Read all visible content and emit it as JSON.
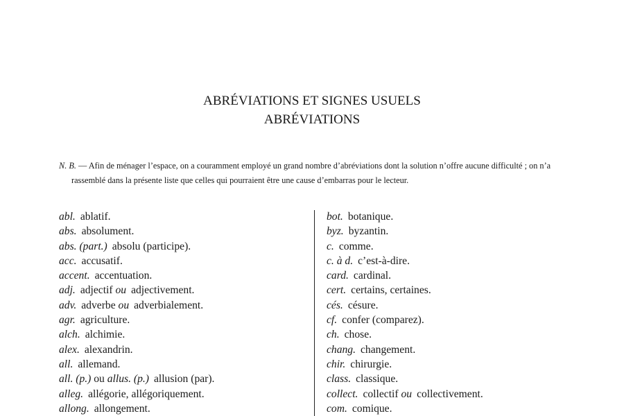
{
  "header": {
    "title": "ABRÉVIATIONS ET SIGNES USUELS",
    "subtitle": "ABRÉVIATIONS"
  },
  "note": {
    "label": "N. B.",
    "text": " — Afin de ménager l’espace, on a couramment employé un grand nombre d’abréviations dont la solution n’offre aucune difficulté ; on n’a rassemblé dans la présente liste que celles qui pourraient être une cause d’embarras pour le lecteur."
  },
  "left_entries": [
    {
      "abbr": "abl.",
      "def": "ablatif."
    },
    {
      "abbr": "abs.",
      "def": "absolument."
    },
    {
      "abbr": "abs. (part.)",
      "def": "absolu (participe)."
    },
    {
      "abbr": "acc.",
      "def": "accusatif."
    },
    {
      "abbr": "accent.",
      "def": "accentuation."
    },
    {
      "abbr": "adj.",
      "def_a": "adjectif",
      "conj": "ou",
      "def_b": "adjectivement."
    },
    {
      "abbr": "adv.",
      "def_a": "adverbe",
      "conj": "ou",
      "def_b": "adverbialement."
    },
    {
      "abbr": "agr.",
      "def": "agriculture."
    },
    {
      "abbr": "alch.",
      "def": "alchimie."
    },
    {
      "abbr": "alex.",
      "def": "alexandrin."
    },
    {
      "abbr": "all.",
      "def": "allemand."
    },
    {
      "abbr": "all. (p.)",
      "mid": "ou",
      "abbr2": "allus. (p.)",
      "def": "allusion (par)."
    },
    {
      "abbr": "alleg.",
      "def": "allégorie, allégoriquement."
    },
    {
      "abbr": "allong.",
      "def": "allongement."
    }
  ],
  "right_entries": [
    {
      "abbr": "bot.",
      "def": "botanique."
    },
    {
      "abbr": "byz.",
      "def": "byzantin."
    },
    {
      "abbr": "c.",
      "def": "comme."
    },
    {
      "abbr": "c. à d.",
      "def": "c’est-à-dire."
    },
    {
      "abbr": "card.",
      "def": "cardinal."
    },
    {
      "abbr": "cert.",
      "def": "certains, certaines."
    },
    {
      "abbr": "cés.",
      "def": "césure."
    },
    {
      "abbr": "cf.",
      "def": "confer (comparez)."
    },
    {
      "abbr": "ch.",
      "def": "chose."
    },
    {
      "abbr": "chang.",
      "def": "changement."
    },
    {
      "abbr": "chir.",
      "def": "chirurgie."
    },
    {
      "abbr": "class.",
      "def": "classique."
    },
    {
      "abbr": "collect.",
      "def_a": "collectif",
      "conj": "ou",
      "def_b": "collectivement."
    },
    {
      "abbr": "com.",
      "def": "comique."
    }
  ]
}
